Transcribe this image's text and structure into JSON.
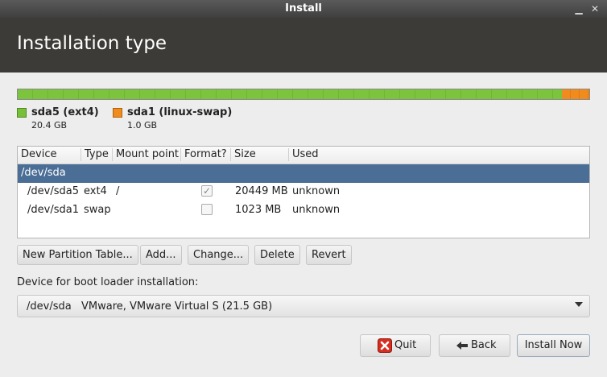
{
  "window": {
    "title": "Install"
  },
  "header": {
    "title": "Installation type"
  },
  "partition_bar": {
    "segments": [
      {
        "name": "sda5 (ext4)",
        "size": "20.4 GB",
        "color": "#78c03a",
        "fraction": 0.952
      },
      {
        "name": "sda1 (linux-swap)",
        "size": "1.0 GB",
        "color": "#f08c1e",
        "fraction": 0.048
      }
    ]
  },
  "table": {
    "headers": [
      "Device",
      "Type",
      "Mount point",
      "Format?",
      "Size",
      "Used"
    ],
    "group": "/dev/sda",
    "rows": [
      {
        "device": "/dev/sda5",
        "type": "ext4",
        "mount": "/",
        "format": true,
        "size": "20449 MB",
        "used": "unknown"
      },
      {
        "device": "/dev/sda1",
        "type": "swap",
        "mount": "",
        "format": false,
        "size": "1023 MB",
        "used": "unknown"
      }
    ]
  },
  "actions": {
    "new_table": "New Partition Table...",
    "add": "Add...",
    "change": "Change...",
    "delete": "Delete",
    "revert": "Revert"
  },
  "bootloader": {
    "label": "Device for boot loader installation:",
    "device": "/dev/sda",
    "description": "VMware, VMware Virtual S (21.5 GB)"
  },
  "footer": {
    "quit": "Quit",
    "back": "Back",
    "install": "Install Now"
  },
  "colors": {
    "header_bg": "#3c3b37",
    "selection": "#4a6e95",
    "quit_icon": "#d62d20"
  }
}
